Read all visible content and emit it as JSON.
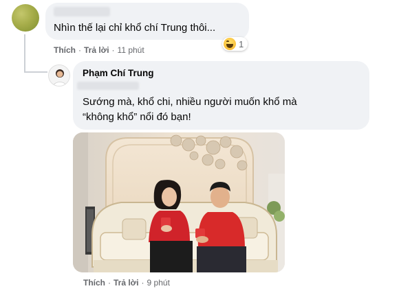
{
  "comment1": {
    "text": "Nhìn thế lại chỉ khổ chí Trung thôi...",
    "reaction_count": "1",
    "reaction_icon": "haha-emoji-icon",
    "actions": {
      "like": "Thích",
      "reply": "Trả lời",
      "time": "11 phút"
    }
  },
  "comment2": {
    "author": "Phạm Chí Trung",
    "text_line1": "Sướng mà, khổ chi, nhiều người muốn khổ mà",
    "text_line2": "“không khổ” nổi đó bạn!",
    "actions": {
      "like": "Thích",
      "reply": "Trả lời",
      "time": "9 phút"
    }
  },
  "colors": {
    "bubble": "#f0f2f5",
    "meta": "#65676b",
    "text": "#050505"
  }
}
